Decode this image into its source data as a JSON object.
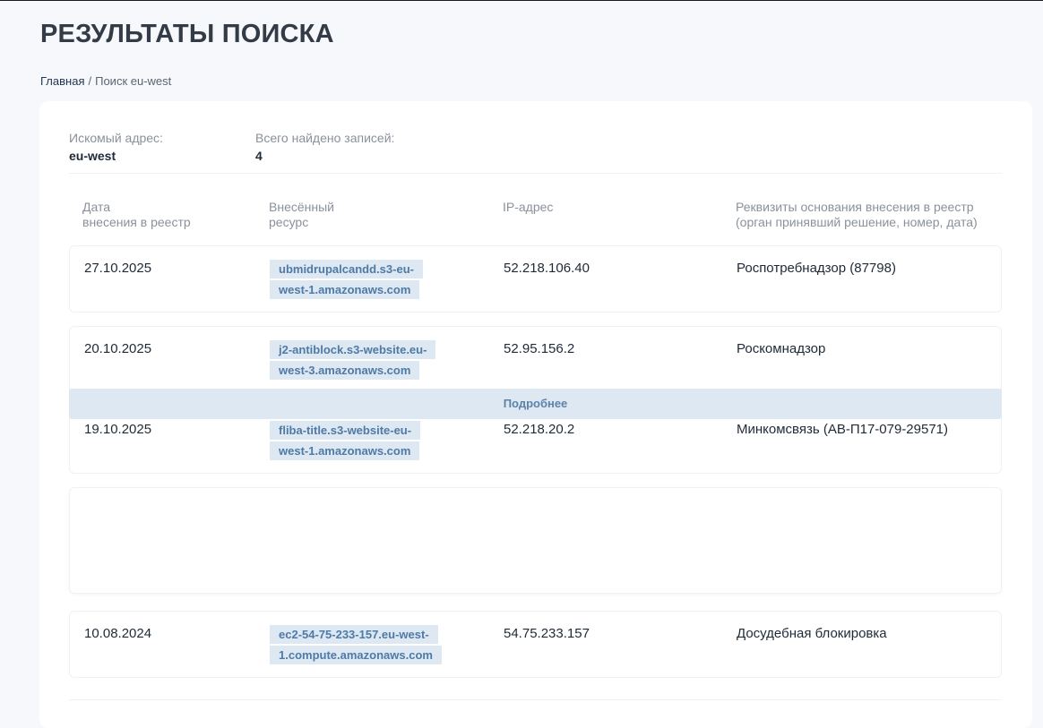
{
  "page": {
    "title": "РЕЗУЛЬТАТЫ ПОИСКА",
    "breadcrumb": {
      "home": "Главная",
      "separator": "/",
      "current": "Поиск eu-west"
    }
  },
  "summary": {
    "address_label": "Искомый адрес:",
    "address_value": "eu-west",
    "count_label": "Всего найдено записей:",
    "count_value": "4"
  },
  "table": {
    "headers": {
      "date": [
        "Дата",
        "внесения в реестр"
      ],
      "resource": [
        "Внесённый",
        "ресурс"
      ],
      "ip": [
        "IP-адрес"
      ],
      "basis": [
        "Реквизиты основания внесения в реестр",
        "(орган принявший решение, номер, дата)"
      ]
    },
    "rows": [
      {
        "date": "27.10.2025",
        "resource": "ubmidrupalcandd.s3-eu-west-1.amazonaws.com",
        "ip": "52.218.106.40",
        "basis": "Роспотребнадзор (87798)"
      },
      {
        "date": "20.10.2025",
        "resource": "j2-antiblock.s3-website.eu-west-3.amazonaws.com",
        "ip": "52.95.156.2",
        "basis": "Роскомнадзор"
      },
      {
        "date": "19.10.2025",
        "resource": "fliba-title.s3-website-eu-west-1.amazonaws.com",
        "ip": "52.218.20.2",
        "basis": "Минкомсвязь (АВ-П17-079-29571)"
      },
      {
        "date": "10.08.2024",
        "resource": "ec2-54-75-233-157.eu-west-1.compute.amazonaws.com",
        "ip": "54.75.233.157",
        "basis": "Досудебная блокировка"
      }
    ],
    "more_label": "Подробнее"
  }
}
